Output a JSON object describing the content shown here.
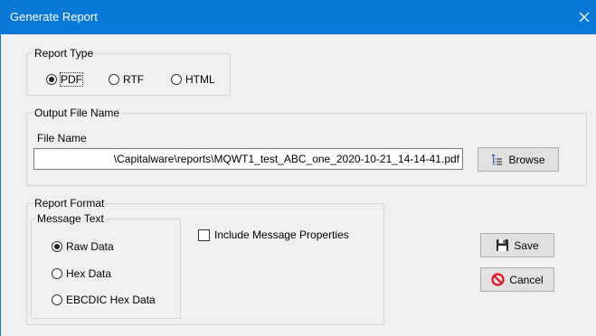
{
  "window": {
    "title": "Generate Report"
  },
  "report_type": {
    "legend": "Report Type",
    "options": [
      {
        "label": "PDF",
        "selected": true
      },
      {
        "label": "RTF",
        "selected": false
      },
      {
        "label": "HTML",
        "selected": false
      }
    ]
  },
  "output_file": {
    "legend": "Output File Name",
    "field_label": "File Name",
    "value": "\\Capitalware\\reports\\MQWT1_test_ABC_one_2020-10-21_14-14-41.pdf",
    "browse_label": "Browse",
    "browse_icon": "file-tree-icon"
  },
  "report_format": {
    "legend": "Report Format",
    "message_text": {
      "legend": "Message Text",
      "options": [
        {
          "label": "Raw Data",
          "selected": true
        },
        {
          "label": "Hex Data",
          "selected": false
        },
        {
          "label": "EBCDIC Hex Data",
          "selected": false
        }
      ]
    },
    "include_properties": {
      "label": "Include Message Properties",
      "checked": false
    }
  },
  "buttons": {
    "save": {
      "label": "Save",
      "icon": "floppy-disk-icon"
    },
    "cancel": {
      "label": "Cancel",
      "icon": "prohibited-icon",
      "icon_color": "#e81123"
    }
  },
  "colors": {
    "titlebar": "#0a78d7",
    "dialog_bg": "#f0f0f0"
  }
}
